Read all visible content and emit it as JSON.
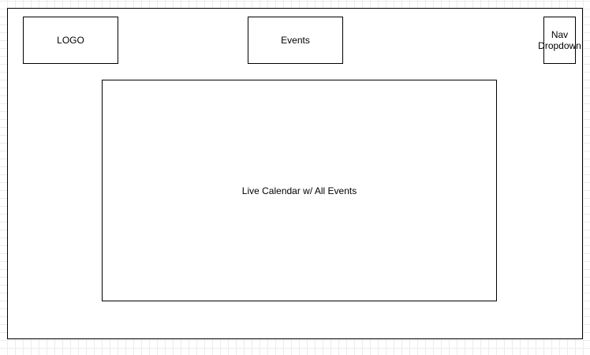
{
  "wireframe": {
    "logo_label": "LOGO",
    "events_label": "Events",
    "nav_label_line1": "Nav",
    "nav_label_line2": "Dropdown",
    "calendar_label": "Live Calendar w/ All Events"
  }
}
